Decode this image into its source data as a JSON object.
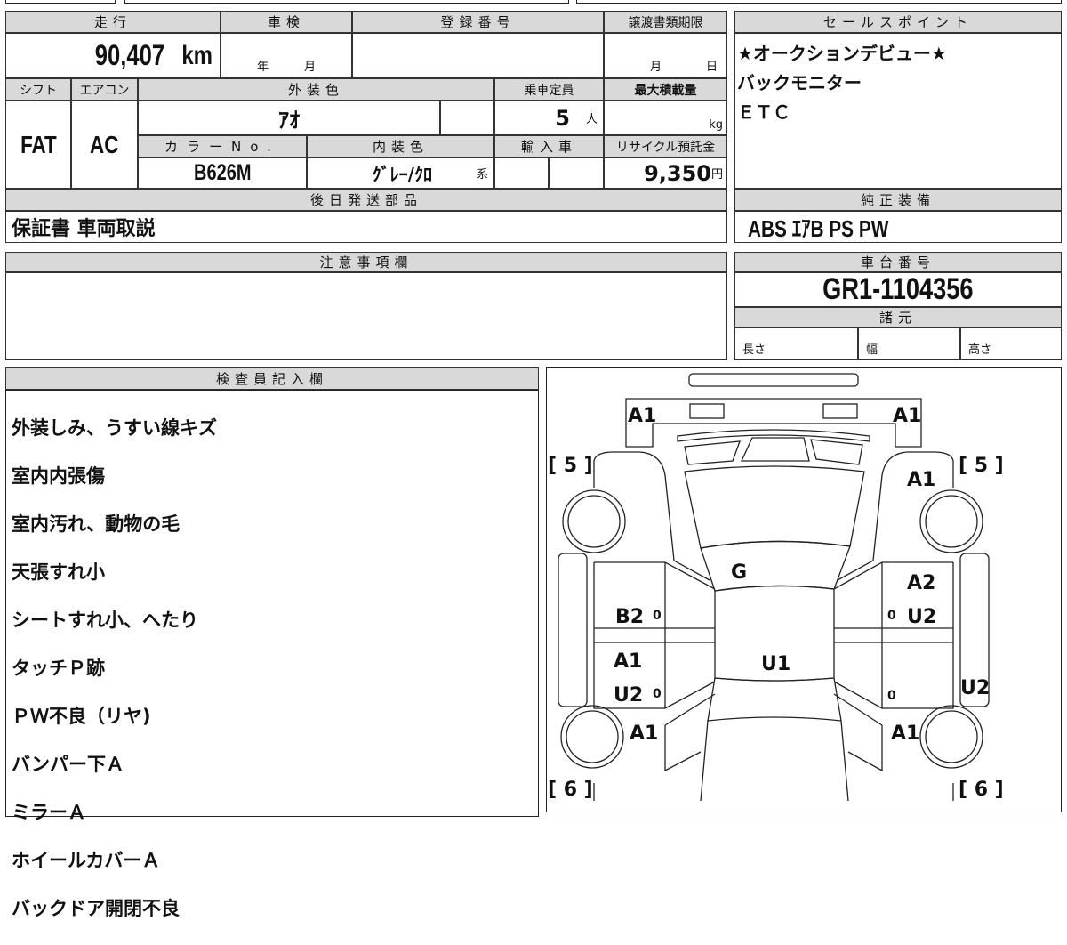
{
  "mileage": {
    "label": "走行",
    "value": "90,407",
    "unit": "km"
  },
  "shaken": {
    "label": "車検",
    "year_unit": "年",
    "month_unit": "月"
  },
  "registration": {
    "label": "登録番号",
    "value": ""
  },
  "transfer_deadline": {
    "label": "譲渡書類期限",
    "month_unit": "月",
    "day_unit": "日"
  },
  "shift": {
    "label": "シフト",
    "value": "FAT"
  },
  "aircon": {
    "label": "エアコン",
    "value": "AC"
  },
  "exterior_color": {
    "label": "外装色",
    "value": "ｱｵ"
  },
  "capacity": {
    "label": "乗車定員",
    "value": "5",
    "unit": "人"
  },
  "max_load": {
    "label": "最大積載量",
    "unit": "kg"
  },
  "color_no": {
    "label": "カラーNo.",
    "value": "B626M"
  },
  "interior_color": {
    "label": "内装色",
    "value": "ｸﾞﾚｰ/ｸﾛ",
    "suffix": "系"
  },
  "import": {
    "label": "輸入車"
  },
  "recycle": {
    "label": "リサイクル預託金",
    "value": "9,350",
    "unit": "円"
  },
  "later_parts": {
    "label": "後日発送部品",
    "value": "保証書 車両取説"
  },
  "sales_points": {
    "label": "セールスポイント",
    "lines": [
      "★オークションデビュー★",
      "バックモニター",
      "ＥＴＣ"
    ]
  },
  "equipment": {
    "label": "純正装備",
    "value": "ABS ｴｱB PS PW"
  },
  "notes": {
    "label": "注意事項欄",
    "value": ""
  },
  "chassis": {
    "label": "車台番号",
    "value": "GR1-1104356"
  },
  "specs": {
    "label": "諸元",
    "length": "長さ",
    "width": "幅",
    "height": "高さ"
  },
  "inspector": {
    "label": "検査員記入欄",
    "lines": [
      "外装しみ、うすい線キズ",
      "室内内張傷",
      "室内汚れ、動物の毛",
      "天張すれ小",
      "シートすれ小、へたり",
      "タッチＰ跡",
      "ＰＷ不良（リヤ)",
      "バンパー下Ａ",
      "ミラーＡ",
      "ホイールカバーＡ",
      "バックドア開閉不良"
    ]
  },
  "diagram": {
    "marks": [
      "A1",
      "A1",
      "[ 5 ]",
      "[ 5 ]",
      "A1",
      "G",
      "B2",
      "0",
      "A2",
      "0",
      "U2",
      "A1",
      "U1",
      "U2",
      "0",
      "0",
      "U2",
      "A1",
      "A1",
      "[ 6 ]",
      "[ 6 ]"
    ]
  }
}
